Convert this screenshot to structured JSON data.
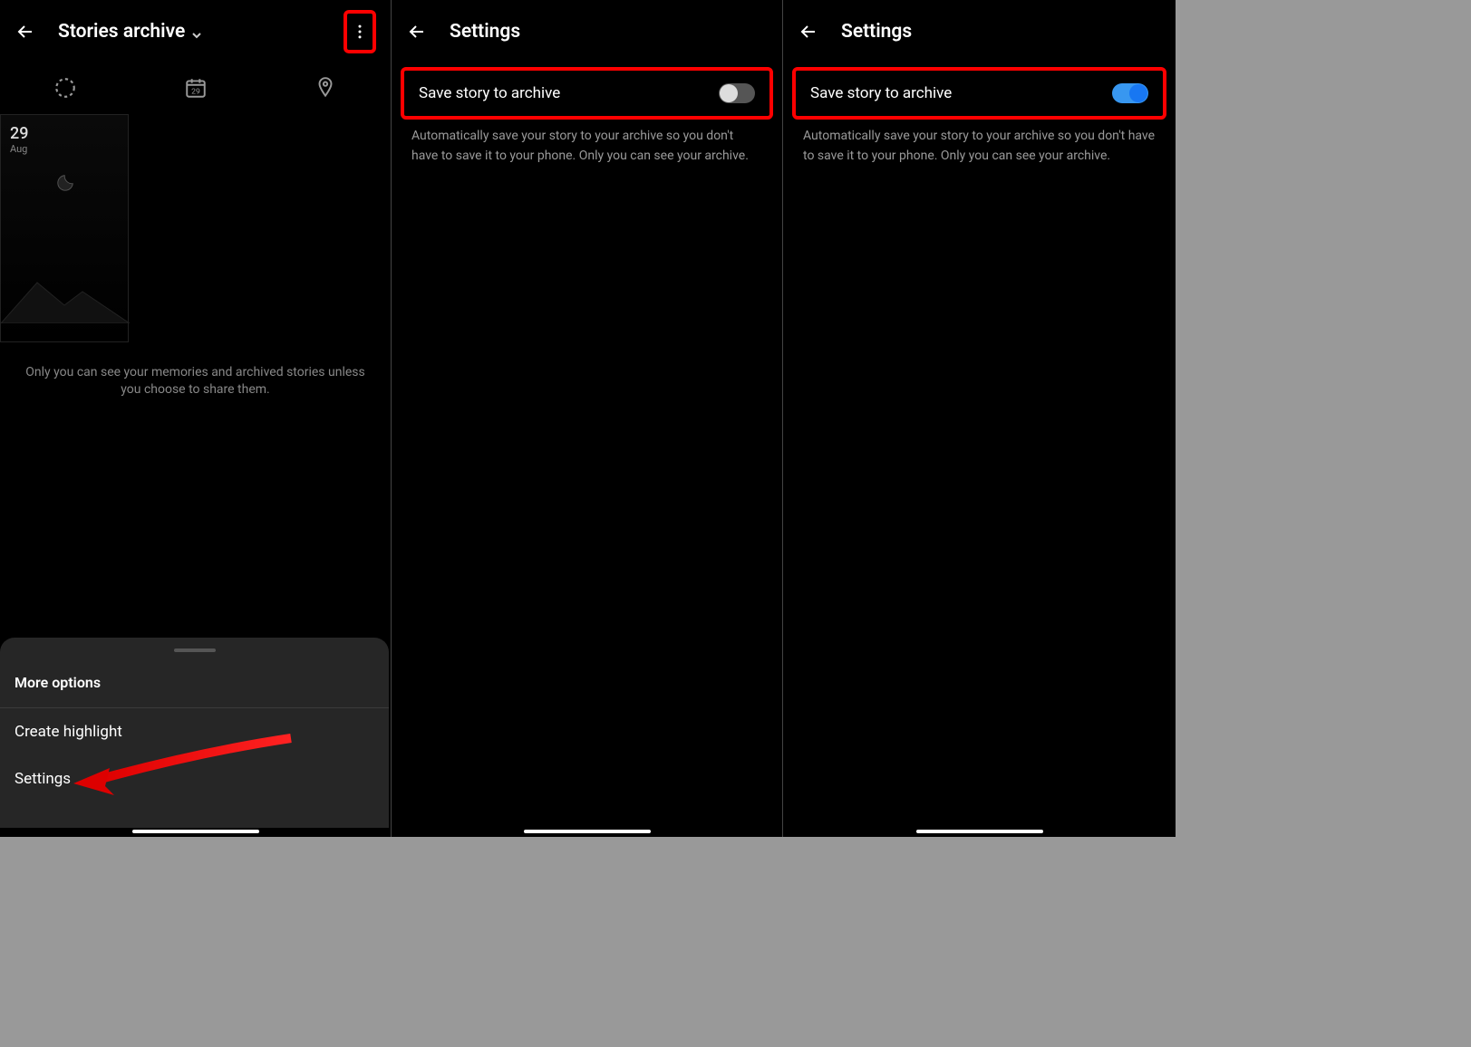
{
  "panel1": {
    "title": "Stories archive",
    "calendar_day": "29",
    "story": {
      "day": "29",
      "month": "Aug"
    },
    "notice": "Only you can see your memories and archived stories unless you choose to share them.",
    "sheet": {
      "title": "More options",
      "items": [
        "Create highlight",
        "Settings"
      ]
    }
  },
  "panel2": {
    "title": "Settings",
    "setting_label": "Save story to archive",
    "toggle_on": false,
    "description": "Automatically save your story to your archive so you don't have to save it to your phone. Only you can see your archive."
  },
  "panel3": {
    "title": "Settings",
    "setting_label": "Save story to archive",
    "toggle_on": true,
    "description": "Automatically save your story to your archive so you don't have to save it to your phone. Only you can see your archive."
  }
}
